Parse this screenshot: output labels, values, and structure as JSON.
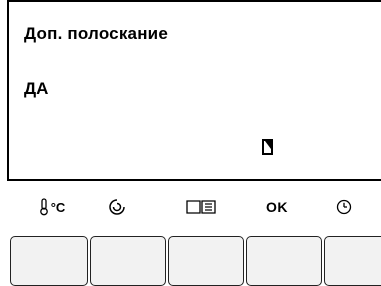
{
  "display": {
    "title": "Доп. полоскание",
    "value": "ДА"
  },
  "icons": [
    {
      "name": "temperature-icon",
      "label": "°C"
    },
    {
      "name": "spin-icon"
    },
    {
      "name": "book-icon"
    },
    {
      "name": "ok",
      "label": "OK"
    },
    {
      "name": "clock-icon"
    }
  ]
}
